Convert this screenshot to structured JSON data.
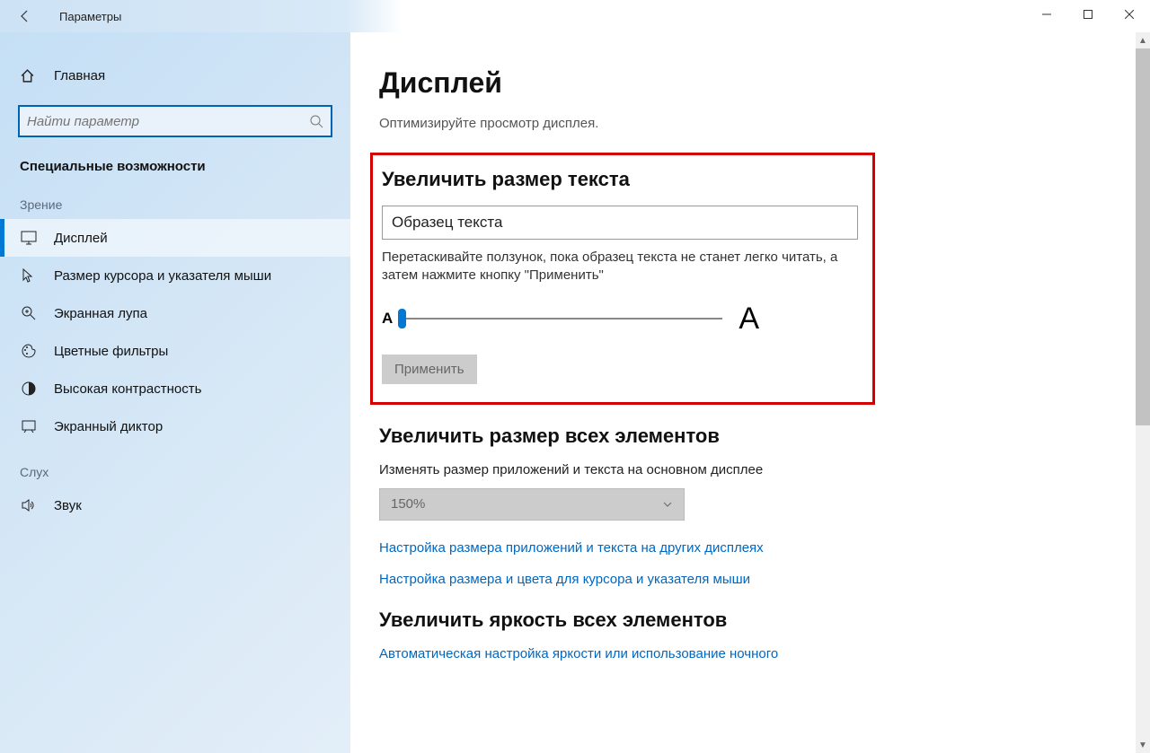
{
  "titlebar": {
    "title": "Параметры"
  },
  "sidebar": {
    "home": "Главная",
    "search_placeholder": "Найти параметр",
    "section": "Специальные возможности",
    "group_vision": "Зрение",
    "group_hearing": "Слух",
    "items_vision": [
      {
        "label": "Дисплей",
        "active": true
      },
      {
        "label": "Размер курсора и указателя мыши"
      },
      {
        "label": "Экранная лупа"
      },
      {
        "label": "Цветные фильтры"
      },
      {
        "label": "Высокая контрастность"
      },
      {
        "label": "Экранный диктор"
      }
    ],
    "items_hearing": [
      {
        "label": "Звук"
      }
    ]
  },
  "content": {
    "heading": "Дисплей",
    "subtitle": "Оптимизируйте просмотр дисплея.",
    "text_size": {
      "title": "Увеличить размер текста",
      "sample": "Образец текста",
      "note": "Перетаскивайте ползунок, пока образец текста не станет легко читать, а затем нажмите кнопку \"Применить\"",
      "small_a": "A",
      "big_a": "A",
      "apply": "Применить"
    },
    "everything": {
      "title": "Увеличить размер всех элементов",
      "desc": "Изменять размер приложений и текста на основном дисплее",
      "dropdown": "150%",
      "link1": "Настройка размера приложений и текста на других дисплеях",
      "link2": "Настройка размера и цвета для курсора и указателя мыши"
    },
    "brightness": {
      "title": "Увеличить яркость всех элементов",
      "link": "Автоматическая настройка яркости или использование ночного"
    }
  }
}
